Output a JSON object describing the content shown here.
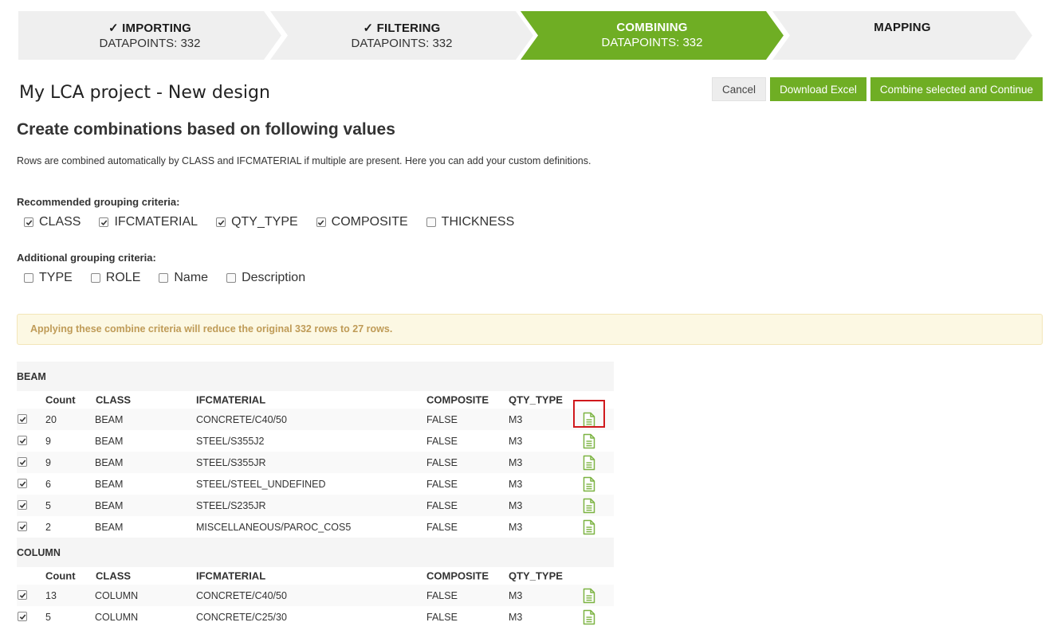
{
  "stepper": {
    "steps": [
      {
        "title": "✓ IMPORTING",
        "subtitle": "DATAPOINTS: 332",
        "state": "done"
      },
      {
        "title": "✓ FILTERING",
        "subtitle": "DATAPOINTS: 332",
        "state": "done"
      },
      {
        "title": "COMBINING",
        "subtitle": "DATAPOINTS: 332",
        "state": "active"
      },
      {
        "title": "MAPPING",
        "subtitle": "",
        "state": "pending"
      }
    ]
  },
  "project_title": "My LCA project - New design",
  "buttons": {
    "cancel": "Cancel",
    "download": "Download Excel",
    "combine": "Combine selected and Continue"
  },
  "heading": "Create combinations based on following values",
  "description": "Rows are combined automatically by CLASS and IFCMATERIAL if multiple are present. Here you can add your custom definitions.",
  "recommended": {
    "label": "Recommended grouping criteria:",
    "options": [
      {
        "label": "CLASS",
        "checked": true
      },
      {
        "label": "IFCMATERIAL",
        "checked": true
      },
      {
        "label": "QTY_TYPE",
        "checked": true
      },
      {
        "label": "COMPOSITE",
        "checked": true
      },
      {
        "label": "THICKNESS",
        "checked": false
      }
    ]
  },
  "additional": {
    "label": "Additional grouping criteria:",
    "options": [
      {
        "label": "TYPE",
        "checked": false
      },
      {
        "label": "ROLE",
        "checked": false
      },
      {
        "label": "Name",
        "checked": false
      },
      {
        "label": "Description",
        "checked": false
      }
    ]
  },
  "alert": "Applying these combine criteria will reduce the original 332 rows to 27 rows.",
  "columns": [
    "Count",
    "CLASS",
    "IFCMATERIAL",
    "COMPOSITE",
    "QTY_TYPE"
  ],
  "groups": [
    {
      "name": "BEAM",
      "rows": [
        {
          "checked": true,
          "count": "20",
          "class": "BEAM",
          "material": "CONCRETE/C40/50",
          "composite": "FALSE",
          "qty": "M3"
        },
        {
          "checked": true,
          "count": "9",
          "class": "BEAM",
          "material": "STEEL/S355J2",
          "composite": "FALSE",
          "qty": "M3"
        },
        {
          "checked": true,
          "count": "9",
          "class": "BEAM",
          "material": "STEEL/S355JR",
          "composite": "FALSE",
          "qty": "M3"
        },
        {
          "checked": true,
          "count": "6",
          "class": "BEAM",
          "material": "STEEL/STEEL_UNDEFINED",
          "composite": "FALSE",
          "qty": "M3"
        },
        {
          "checked": true,
          "count": "5",
          "class": "BEAM",
          "material": "STEEL/S235JR",
          "composite": "FALSE",
          "qty": "M3"
        },
        {
          "checked": true,
          "count": "2",
          "class": "BEAM",
          "material": "MISCELLANEOUS/PAROC_COS5",
          "composite": "FALSE",
          "qty": "M3"
        }
      ]
    },
    {
      "name": "COLUMN",
      "rows": [
        {
          "checked": true,
          "count": "13",
          "class": "COLUMN",
          "material": "CONCRETE/C40/50",
          "composite": "FALSE",
          "qty": "M3"
        },
        {
          "checked": true,
          "count": "5",
          "class": "COLUMN",
          "material": "CONCRETE/C25/30",
          "composite": "FALSE",
          "qty": "M3"
        }
      ]
    }
  ],
  "colors": {
    "accent": "#6fae24",
    "step_inactive": "#efefef",
    "alert_bg": "#fcf8e3",
    "alert_text": "#bf9b57",
    "highlight": "#d0191d"
  },
  "icons": {
    "row_action": "document-icon",
    "checkbox": "checkmark-icon"
  }
}
